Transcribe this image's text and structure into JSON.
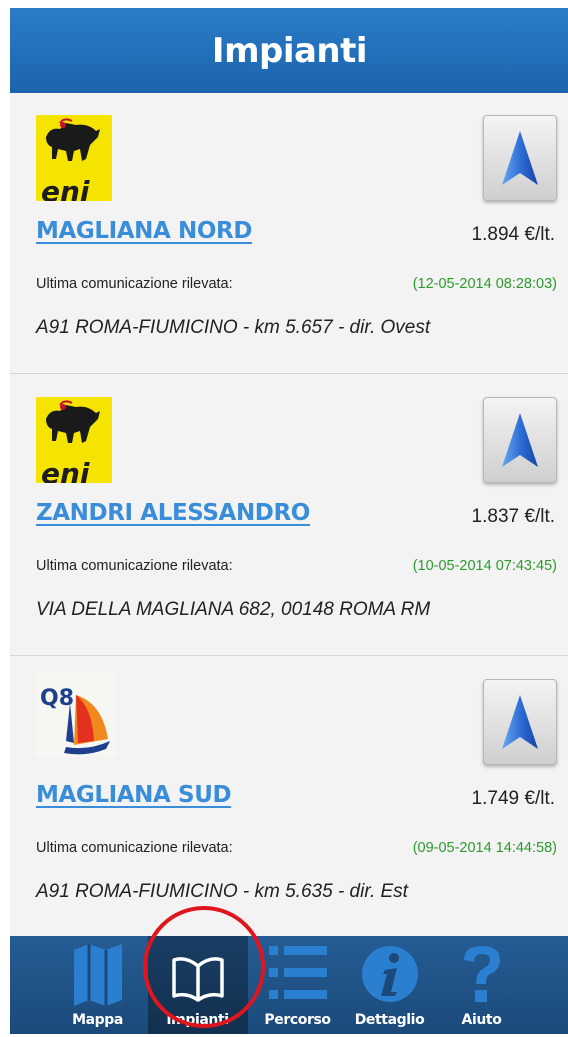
{
  "header": {
    "title": "Impianti"
  },
  "comm_label": "Ultima comunicazione rilevata:",
  "stations": [
    {
      "brand": "eni",
      "brand_text": "eni",
      "name": "MAGLIANA NORD",
      "price": "1.894 €/lt.",
      "last_comm": "(12-05-2014 08:28:03)",
      "address": "A91 ROMA-FIUMICINO - km 5.657 - dir. Ovest"
    },
    {
      "brand": "eni",
      "brand_text": "eni",
      "name": "ZANDRI ALESSANDRO",
      "price": "1.837 €/lt.",
      "last_comm": "(10-05-2014 07:43:45)",
      "address": "VIA DELLA MAGLIANA 682, 00148 ROMA RM"
    },
    {
      "brand": "q8",
      "brand_text": "Q8",
      "name": "MAGLIANA SUD",
      "price": "1.749 €/lt.",
      "last_comm": "(09-05-2014 14:44:58)",
      "address": "A91 ROMA-FIUMICINO - km 5.635 - dir. Est"
    }
  ],
  "tabs": [
    {
      "label": "Mappa",
      "icon": "map-icon"
    },
    {
      "label": "Impianti",
      "icon": "open-book-icon",
      "active": true
    },
    {
      "label": "Percorso",
      "icon": "list-icon"
    },
    {
      "label": "Dettaglio",
      "icon": "info-icon"
    },
    {
      "label": "Aiuto",
      "icon": "question-icon"
    }
  ],
  "colors": {
    "header": "#2b7cc7",
    "station_name": "#3a8dd8",
    "comm_date": "#2e9a2e",
    "tabbar": "#255c94",
    "highlight": "#e0161e"
  }
}
